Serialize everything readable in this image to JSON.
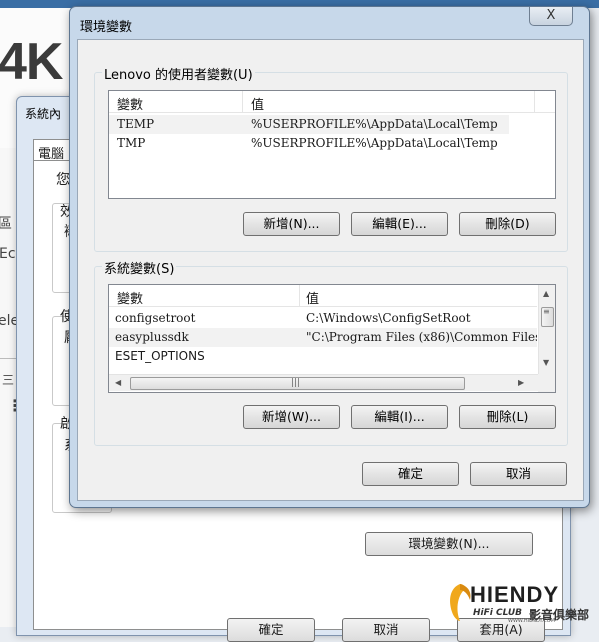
{
  "background": {
    "big_text": "4K",
    "fragments": [
      "Ec",
      "ele"
    ]
  },
  "system_properties": {
    "title": "系統內",
    "tab_label": "電腦",
    "fragments": [
      "您",
      "效",
      "襯",
      "使",
      "厭",
      "啟",
      "系"
    ],
    "env_button": "環境變數(N)...",
    "ok_button": "確定",
    "cancel_button": "取消",
    "apply_button": "套用(A)"
  },
  "env_dialog": {
    "title": "環境變數",
    "close_glyph": "X",
    "user_group": {
      "label": "Lenovo 的使用者變數(U)",
      "col_variable": "變數",
      "col_value": "值",
      "rows": [
        {
          "name": "TEMP",
          "value": "%USERPROFILE%\\AppData\\Local\\Temp"
        },
        {
          "name": "TMP",
          "value": "%USERPROFILE%\\AppData\\Local\\Temp"
        }
      ],
      "new_button": "新增(N)...",
      "edit_button": "編輯(E)...",
      "delete_button": "刪除(D)"
    },
    "system_group": {
      "label": "系統變數(S)",
      "col_variable": "變數",
      "col_value": "值",
      "rows": [
        {
          "name": "configsetroot",
          "value": "C:\\Windows\\ConfigSetRoot"
        },
        {
          "name": "easyplussdk",
          "value": "\"C:\\Program Files (x86)\\Common Files\\"
        },
        {
          "name": "ESET_OPTIONS",
          "value": ""
        }
      ],
      "new_button": "新增(W)...",
      "edit_button": "編輯(I)...",
      "delete_button": "刪除(L)"
    },
    "ok_button": "確定",
    "cancel_button": "取消"
  },
  "watermark": {
    "main": "HIENDY",
    "sub1": "HiFi CLUB",
    "sub2": "影音俱樂部",
    "url": "WWW.HIENDY.COM"
  }
}
